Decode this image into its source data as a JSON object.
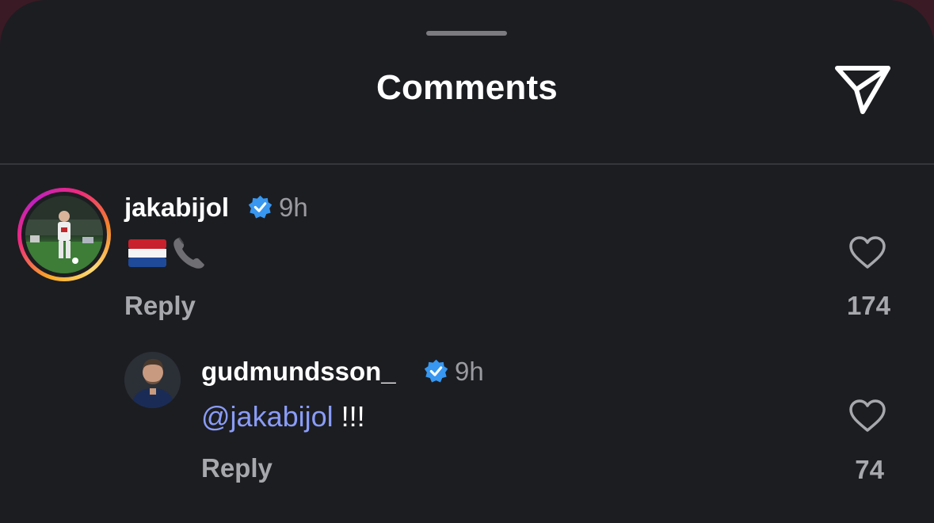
{
  "header": {
    "title": "Comments"
  },
  "comments": [
    {
      "username": "jakabijol",
      "verified": true,
      "time": "9h",
      "body_emoji": [
        "flag-netherlands",
        "telephone-receiver"
      ],
      "reply_label": "Reply",
      "like_count": "174"
    }
  ],
  "replies": [
    {
      "username": "gudmundsson_",
      "verified": true,
      "time": "9h",
      "mention": "@jakabijol",
      "text": " !!!",
      "reply_label": "Reply",
      "like_count": "74"
    }
  ],
  "colors": {
    "sheet_background": "#1c1d21",
    "verified_badge": "#3897f0",
    "mention": "#8a9cf7",
    "muted_text": "#a7a8ad"
  },
  "icons": {
    "share": "paper-plane-icon",
    "like": "heart-outline-icon",
    "verified": "verified-badge-icon"
  }
}
